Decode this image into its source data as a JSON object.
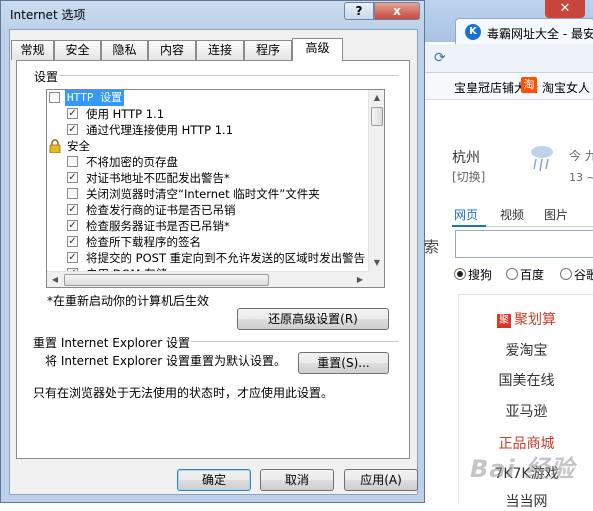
{
  "background": {
    "tab_title": "毒霸网址大全 - 最安",
    "tab_icon": "K",
    "fav1": "宝皇冠店铺大全",
    "fav2_icon": "淘",
    "fav2": "淘宝女人",
    "city": "杭州",
    "city_switch": "[切换]",
    "weather_today": "今 九",
    "weather_range": "13 ~",
    "search_tabs": [
      "网页",
      "视频",
      "图片"
    ],
    "search_label": "索",
    "engines": [
      "搜狗",
      "百度",
      "谷歌"
    ],
    "links": [
      "聚划算",
      "爱淘宝",
      "国美在线",
      "亚马逊",
      "正品商城",
      "7K7K游戏",
      "当当网"
    ],
    "link_badge": "聚",
    "watermark": "Bai 经验"
  },
  "dialog": {
    "title": "Internet 选项",
    "help_button": "?",
    "close_button": "x",
    "tabs": [
      "常规",
      "安全",
      "隐私",
      "内容",
      "连接",
      "程序",
      "高级"
    ],
    "active_tab": 6,
    "settings_group_label": "设置",
    "tree_items": [
      {
        "type": "checkbox",
        "checked": false,
        "label": "HTTP 设置",
        "selected": true,
        "indent": 0
      },
      {
        "type": "checkbox",
        "checked": true,
        "label": "使用 HTTP 1.1",
        "indent": 1
      },
      {
        "type": "checkbox",
        "checked": true,
        "label": "通过代理连接使用 HTTP 1.1",
        "indent": 1
      },
      {
        "type": "category",
        "icon": "lock-icon",
        "label": "安全",
        "indent": 0
      },
      {
        "type": "checkbox",
        "checked": false,
        "label": "不将加密的页存盘",
        "indent": 1
      },
      {
        "type": "checkbox",
        "checked": true,
        "label": "对证书地址不匹配发出警告*",
        "indent": 1
      },
      {
        "type": "checkbox",
        "checked": false,
        "label": "关闭浏览器时清空“Internet 临时文件”文件夹",
        "indent": 1
      },
      {
        "type": "checkbox",
        "checked": true,
        "label": "检查发行商的证书是否已吊销",
        "indent": 1
      },
      {
        "type": "checkbox",
        "checked": true,
        "label": "检查服务器证书是否已吊销*",
        "indent": 1
      },
      {
        "type": "checkbox",
        "checked": true,
        "label": "检查所下载程序的签名",
        "indent": 1
      },
      {
        "type": "checkbox",
        "checked": true,
        "label": "将提交的 POST 重定向到不允许发送的区域时发出警告",
        "indent": 1
      },
      {
        "type": "checkbox",
        "checked": true,
        "label": "启用 DOM 存储",
        "indent": 1
      }
    ],
    "restart_note": "*在重新启动你的计算机后生效",
    "restore_button": "还原高级设置(R)",
    "reset_group_label": "重置 Internet Explorer 设置",
    "reset_description": "将 Internet Explorer 设置重置为默认设置。",
    "reset_button": "重置(S)...",
    "reset_warning": "只有在浏览器处于无法使用的状态时，才应使用此设置。",
    "ok_button": "确定",
    "cancel_button": "取消",
    "apply_button": "应用(A)"
  },
  "colors": {
    "selection": "#3399ff",
    "title_gradient": "#c9dbee",
    "accent_red": "#d23a2a",
    "link_blue": "#1a6fd6"
  }
}
